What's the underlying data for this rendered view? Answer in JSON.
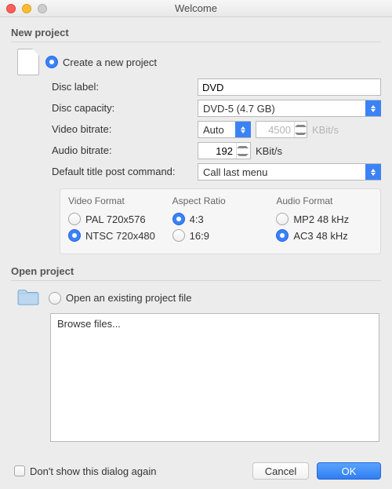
{
  "window": {
    "title": "Welcome"
  },
  "new_project": {
    "section_title": "New project",
    "create_label": "Create a new project",
    "disc_label_label": "Disc label:",
    "disc_label_value": "DVD",
    "disc_capacity_label": "Disc capacity:",
    "disc_capacity_value": "DVD-5 (4.7 GB)",
    "video_bitrate_label": "Video bitrate:",
    "video_bitrate_value": "Auto",
    "video_bitrate_custom": "4500",
    "video_bitrate_unit": "KBit/s",
    "audio_bitrate_label": "Audio bitrate:",
    "audio_bitrate_value": "192",
    "audio_bitrate_unit": "KBit/s",
    "post_command_label": "Default title post command:",
    "post_command_value": "Call last menu",
    "video_format_title": "Video Format",
    "video_format_pal": "PAL 720x576",
    "video_format_ntsc": "NTSC 720x480",
    "aspect_ratio_title": "Aspect Ratio",
    "aspect_43": "4:3",
    "aspect_169": "16:9",
    "audio_format_title": "Audio Format",
    "audio_mp2": "MP2 48 kHz",
    "audio_ac3": "AC3 48 kHz"
  },
  "open_project": {
    "section_title": "Open project",
    "open_label": "Open an existing project file",
    "browse_item": "Browse files..."
  },
  "footer": {
    "dont_show": "Don't show this dialog again",
    "cancel": "Cancel",
    "ok": "OK"
  }
}
